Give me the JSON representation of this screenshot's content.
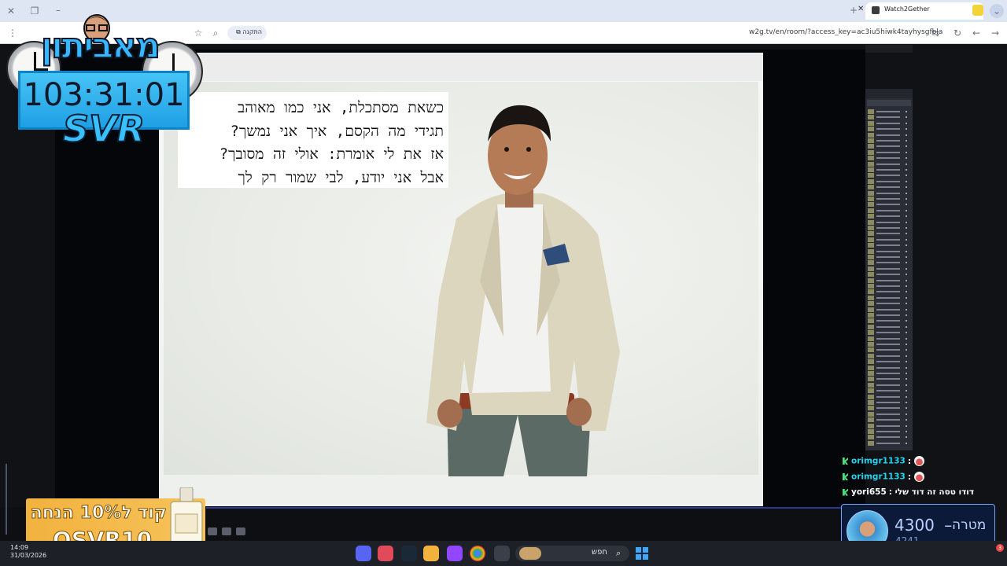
{
  "browser": {
    "tab_title": "Watch2Gether",
    "url": "w2g.tv/en/room/?access_key=ac3iu5hiwk4tayhysgfbla",
    "install_chip": "התקנה"
  },
  "slide": {
    "lyrics": [
      "כשאת מסתכלת, אני כמו מאוהב",
      "תגידי מה הקסם, איך אני נמשך?",
      "אז את לי אומרת: אולי זה מסובך?",
      "אבל אני יודע, לבי שמור רק לך"
    ]
  },
  "overlay": {
    "brand": "מאביתון",
    "timer": "103:31:01",
    "timer_label": "SVR"
  },
  "chat": {
    "messages": [
      {
        "user": "orimgr1133",
        "text": ":",
        "color": "#22d3ee"
      },
      {
        "user": "orimgr1133",
        "text": ":",
        "color": "#22d3ee"
      },
      {
        "user": "yori655",
        "text": ": דודו טסה זה דוד שלי",
        "color": "#ffffff"
      }
    ]
  },
  "goal": {
    "label": "מטרה",
    "separator": "–",
    "target": "4300",
    "current": "4241"
  },
  "promo": {
    "headline": "קוד ל10% הנחה",
    "code": "OSVR10"
  },
  "taskbar": {
    "time": "14:09",
    "date": "31/03/2026",
    "search_label": "חפש",
    "notification_count": "3"
  },
  "colors": {
    "accent": "#1fa0e5",
    "goal_panel": "#0c1a3a",
    "promo": "#f2b23e"
  }
}
